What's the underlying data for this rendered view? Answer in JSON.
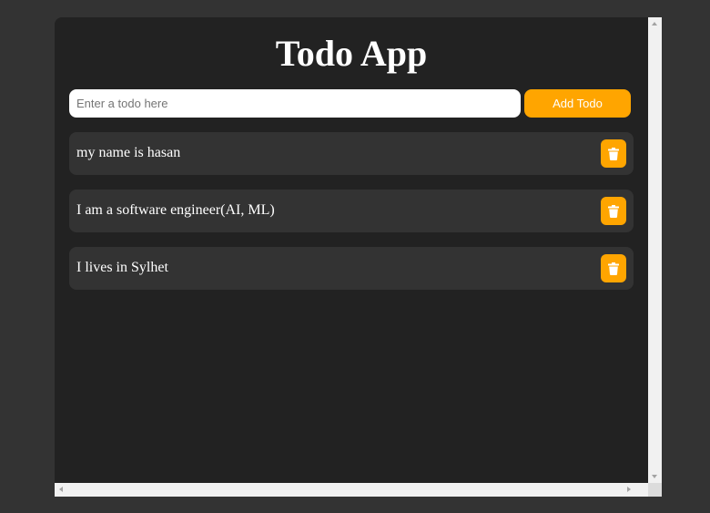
{
  "app": {
    "title": "Todo App"
  },
  "form": {
    "input_value": "",
    "input_placeholder": "Enter a todo here",
    "add_label": "Add Todo"
  },
  "todos": [
    {
      "text": "my name is hasan",
      "action_icon": "trash-icon"
    },
    {
      "text": "I am a software engineer(AI, ML)",
      "action_icon": "trash-icon"
    },
    {
      "text": "I lives in Sylhet",
      "action_icon": "trash-icon"
    }
  ],
  "colors": {
    "page_background": "#333333",
    "panel_background": "#222222",
    "item_background": "#333333",
    "accent": "#ffa500",
    "text": "#ffffff"
  }
}
